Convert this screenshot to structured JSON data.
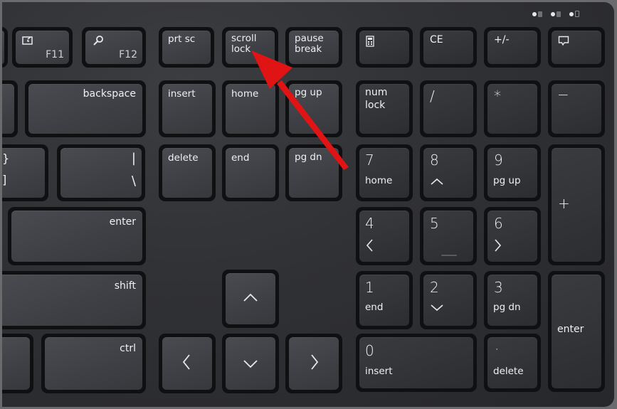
{
  "indicators": [
    "num-lock-led",
    "caps-lock-led",
    "battery-led"
  ],
  "keys": {
    "f11": {
      "label": "F11",
      "icon": "snip-screen-icon"
    },
    "f12": {
      "label": "F12",
      "icon": "search-icon"
    },
    "prtsc": {
      "label": "prt sc"
    },
    "scrolllock": {
      "line1": "scroll",
      "line2": "lock"
    },
    "pause": {
      "line1": "pause",
      "line2": "break"
    },
    "calc": {
      "icon": "calculator-icon"
    },
    "ce": {
      "label": "CE"
    },
    "plusminus": {
      "label": "+/-"
    },
    "chat": {
      "icon": "chat-icon"
    },
    "backspace": {
      "label": "backspace"
    },
    "insert": {
      "label": "insert"
    },
    "home": {
      "label": "home"
    },
    "pgup": {
      "label": "pg up"
    },
    "numlock": {
      "line1": "num",
      "line2": "lock"
    },
    "divide": {
      "label": "/"
    },
    "multiply": {
      "label": "*"
    },
    "minus": {
      "label": "−"
    },
    "brace": {
      "top": "}",
      "bottom": "]"
    },
    "pipe": {
      "top": "|",
      "bottom": "\\"
    },
    "delete": {
      "label": "delete"
    },
    "end": {
      "label": "end"
    },
    "pgdn": {
      "label": "pg dn"
    },
    "n7": {
      "num": "7",
      "sub": "home"
    },
    "n8": {
      "num": "8",
      "sub": "^"
    },
    "n9": {
      "num": "9",
      "sub": "pg up"
    },
    "plus": {
      "label": "+"
    },
    "enter": {
      "label": "enter"
    },
    "n4": {
      "num": "4",
      "sub": "<"
    },
    "n5": {
      "num": "5"
    },
    "n6": {
      "num": "6",
      "sub": ">"
    },
    "shift": {
      "label": "shift"
    },
    "up": {
      "label": "^"
    },
    "n1": {
      "num": "1",
      "sub": "end"
    },
    "n2": {
      "num": "2",
      "sub": "v"
    },
    "n3": {
      "num": "3",
      "sub": "pg dn"
    },
    "numenter": {
      "label": "enter"
    },
    "ctrl": {
      "label": "ctrl"
    },
    "left": {
      "label": "<"
    },
    "down": {
      "label": "v"
    },
    "right": {
      "label": ">"
    },
    "n0": {
      "num": "0",
      "sub": "insert"
    },
    "decimal": {
      "num": "·",
      "sub": "delete"
    }
  },
  "annotation": {
    "type": "arrow",
    "color": "#e01010",
    "points_to": "scroll lock key"
  }
}
